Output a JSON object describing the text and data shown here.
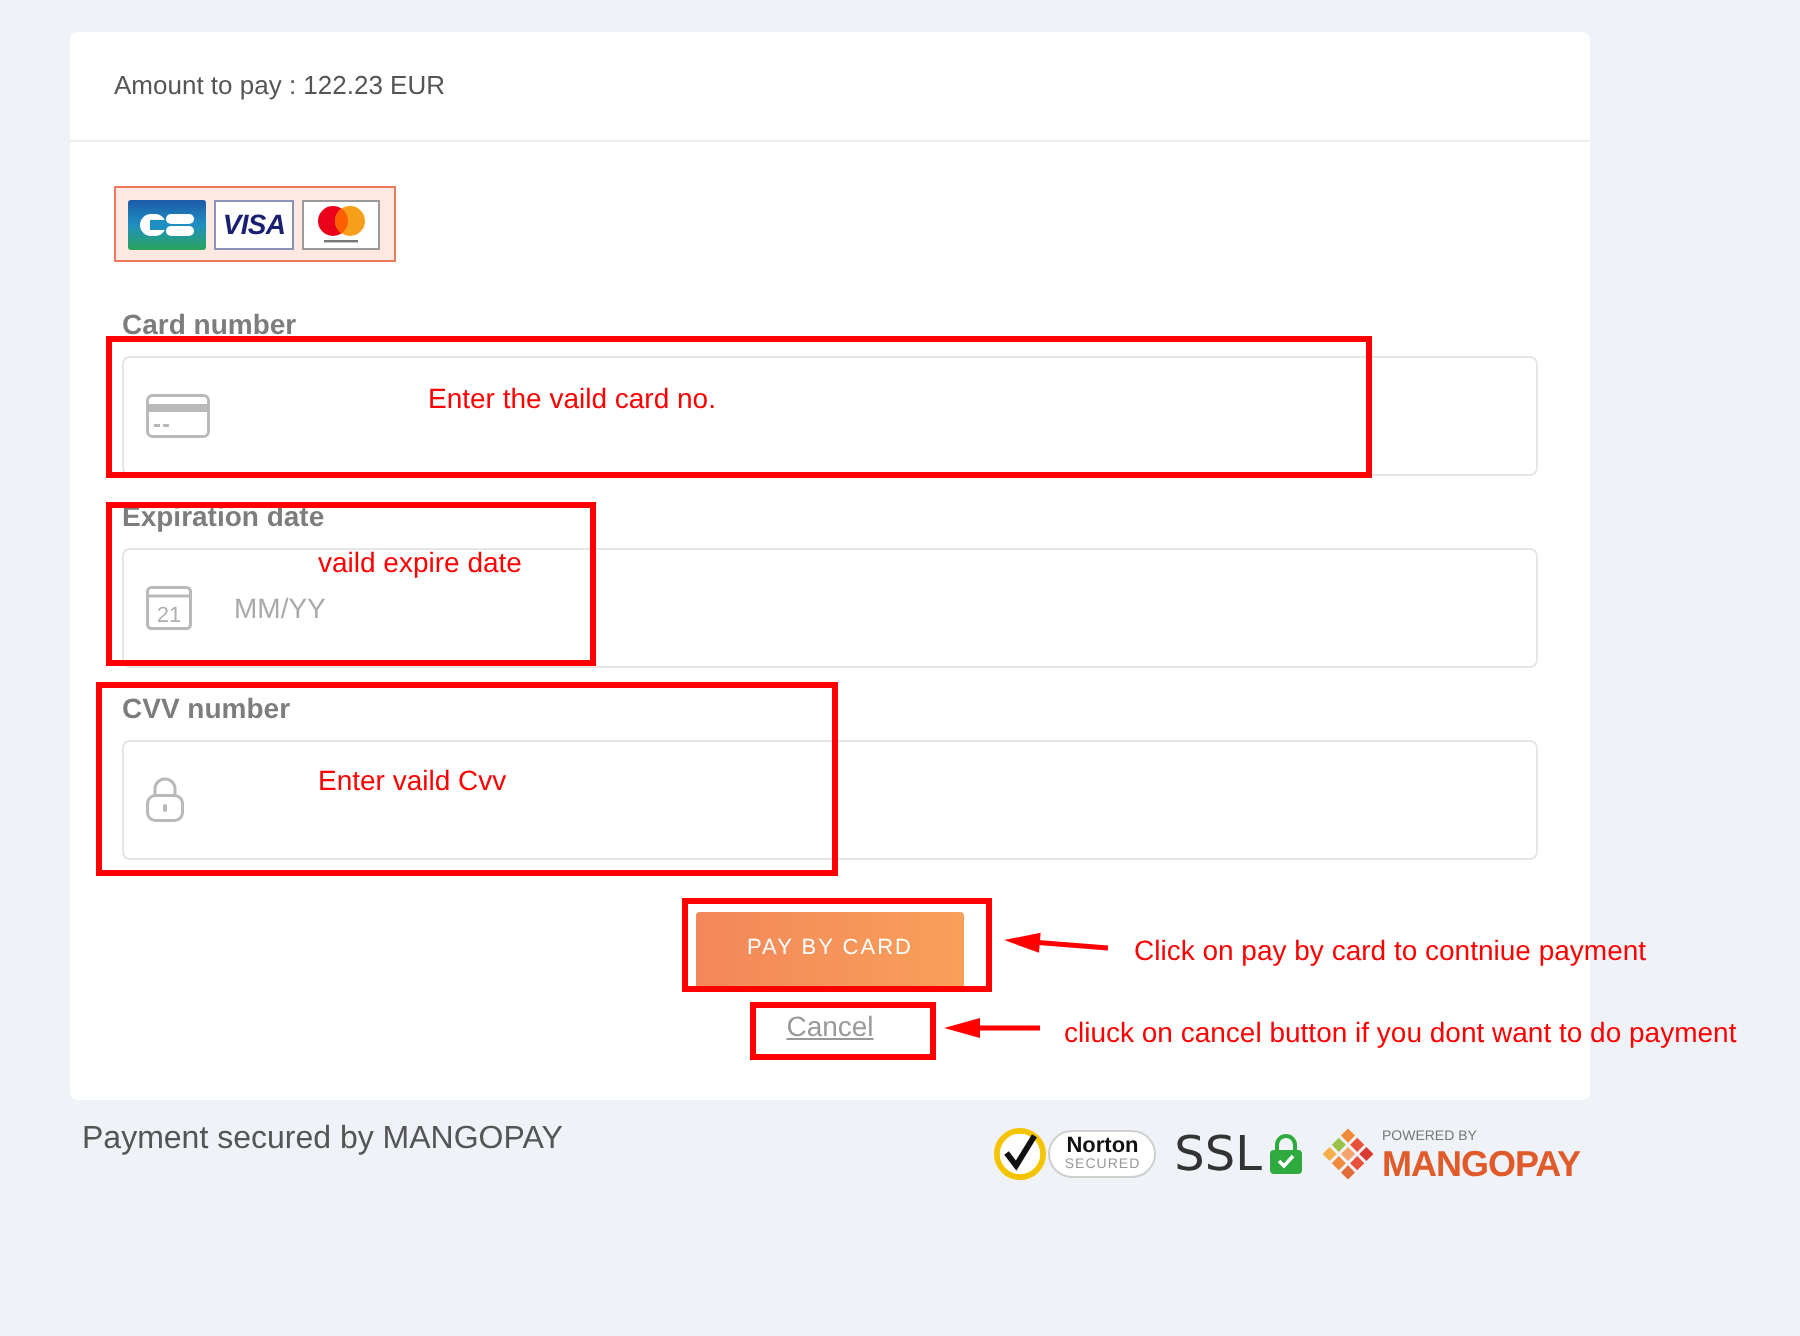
{
  "payment_card": {
    "amount": "Amount to pay : 122.23 EUR",
    "card_logos": [
      {
        "kind": "cb"
      },
      {
        "kind": "visa",
        "text": "VISA"
      },
      {
        "kind": "mastercard"
      }
    ],
    "fields": [
      {
        "label": "Card number",
        "kind": "card"
      },
      {
        "label": "Expiration date",
        "kind": "date",
        "icon_text": "21",
        "placeholder": "MM/YY"
      },
      {
        "label": "CVV number",
        "kind": "cvv"
      }
    ],
    "pay_button": "PAY BY CARD",
    "cancel_link": "Cancel"
  },
  "footer": {
    "text": "Payment secured by MANGOPAY",
    "badges": [
      {
        "kind": "norton",
        "title": "Norton",
        "caption": "SECURED"
      },
      {
        "kind": "ssl",
        "title": "SSL"
      },
      {
        "kind": "mangopay",
        "caption": "POWERED BY",
        "title": "MANGOPAY"
      }
    ]
  },
  "annotations": [
    {
      "kind": "box"
    },
    {
      "kind": "note",
      "text": "Enter the vaild card no."
    },
    {
      "kind": "box"
    },
    {
      "kind": "note",
      "text": "vaild expire date"
    },
    {
      "kind": "box"
    },
    {
      "kind": "note",
      "text": "Enter vaild Cvv"
    },
    {
      "kind": "box"
    },
    {
      "kind": "arrow"
    },
    {
      "kind": "note",
      "text": "Click on pay by card to contniue payment"
    },
    {
      "kind": "box"
    },
    {
      "kind": "arrow"
    },
    {
      "kind": "note",
      "text": "cliuck on cancel button if you dont want to do payment"
    }
  ]
}
